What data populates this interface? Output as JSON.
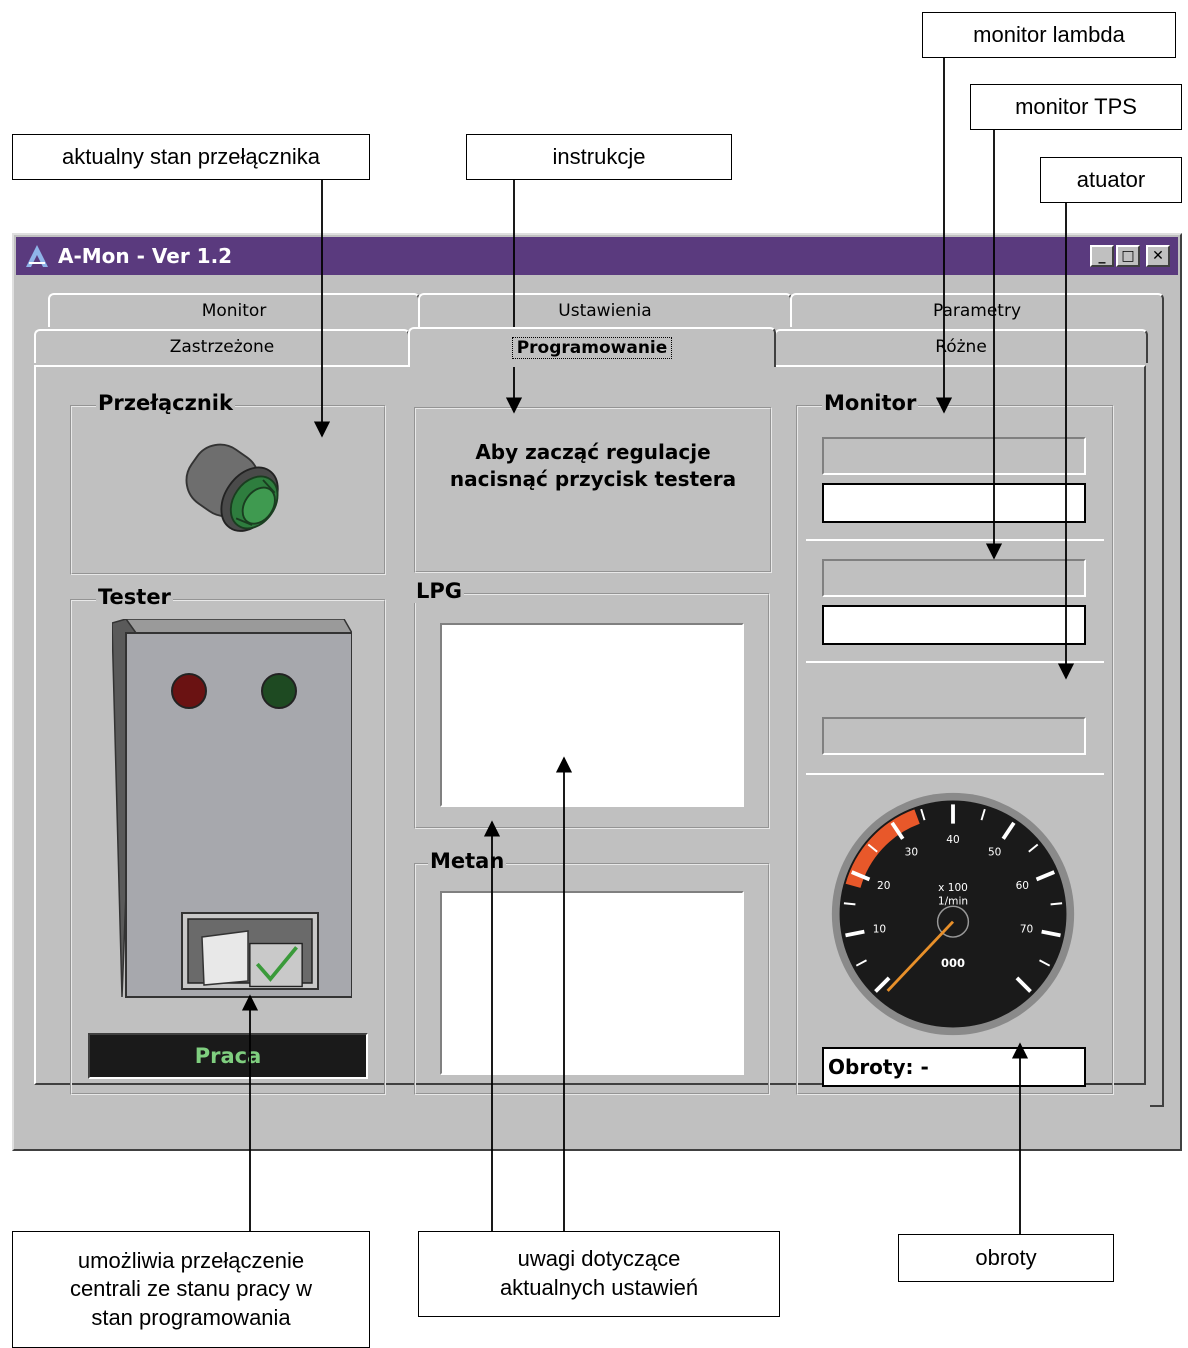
{
  "callouts": {
    "monitor_lambda": "monitor lambda",
    "monitor_tps": "monitor TPS",
    "switch_state": "aktualny stan przełącznika",
    "instructions": "instrukcje",
    "actuator": "atuator",
    "switch_desc_1": "umożliwia przełączenie",
    "switch_desc_2": "centrali ze stanu pracy w",
    "switch_desc_3": "stan programowania",
    "notes_1": "uwagi dotyczące",
    "notes_2": "aktualnych ustawień",
    "rpm": "obroty"
  },
  "window": {
    "title": "A-Mon - Ver 1.2",
    "minimize": "_",
    "maximize": "□",
    "close": "✕"
  },
  "tabs": {
    "row_back": [
      "Monitor",
      "Ustawienia",
      "Parametry"
    ],
    "row_front": [
      "Zastrzeżone",
      "Programowanie",
      "Różne"
    ],
    "active": "Programowanie"
  },
  "groups": {
    "switch": "Przełącznik",
    "tester": "Tester",
    "lpg": "LPG",
    "metan": "Metan",
    "monitor": "Monitor"
  },
  "instruction_text": {
    "line1": "Aby zacząć regulacje",
    "line2": "nacisnąć przycisk testera"
  },
  "tester_status": "Praca",
  "rpm_readout": "Obroty:  -",
  "gauge": {
    "ticks": [
      "10",
      "20",
      "30",
      "40",
      "50",
      "60",
      "70"
    ],
    "unit_line1": "x 100",
    "unit_line2": "1/min",
    "counter": "000",
    "redline_color": "#e8582a"
  },
  "icons": {
    "app": "a-mon-logo-icon",
    "switch_knob": "rotary-switch-icon",
    "tester_device": "tester-device-icon",
    "check": "checkmark-icon"
  }
}
